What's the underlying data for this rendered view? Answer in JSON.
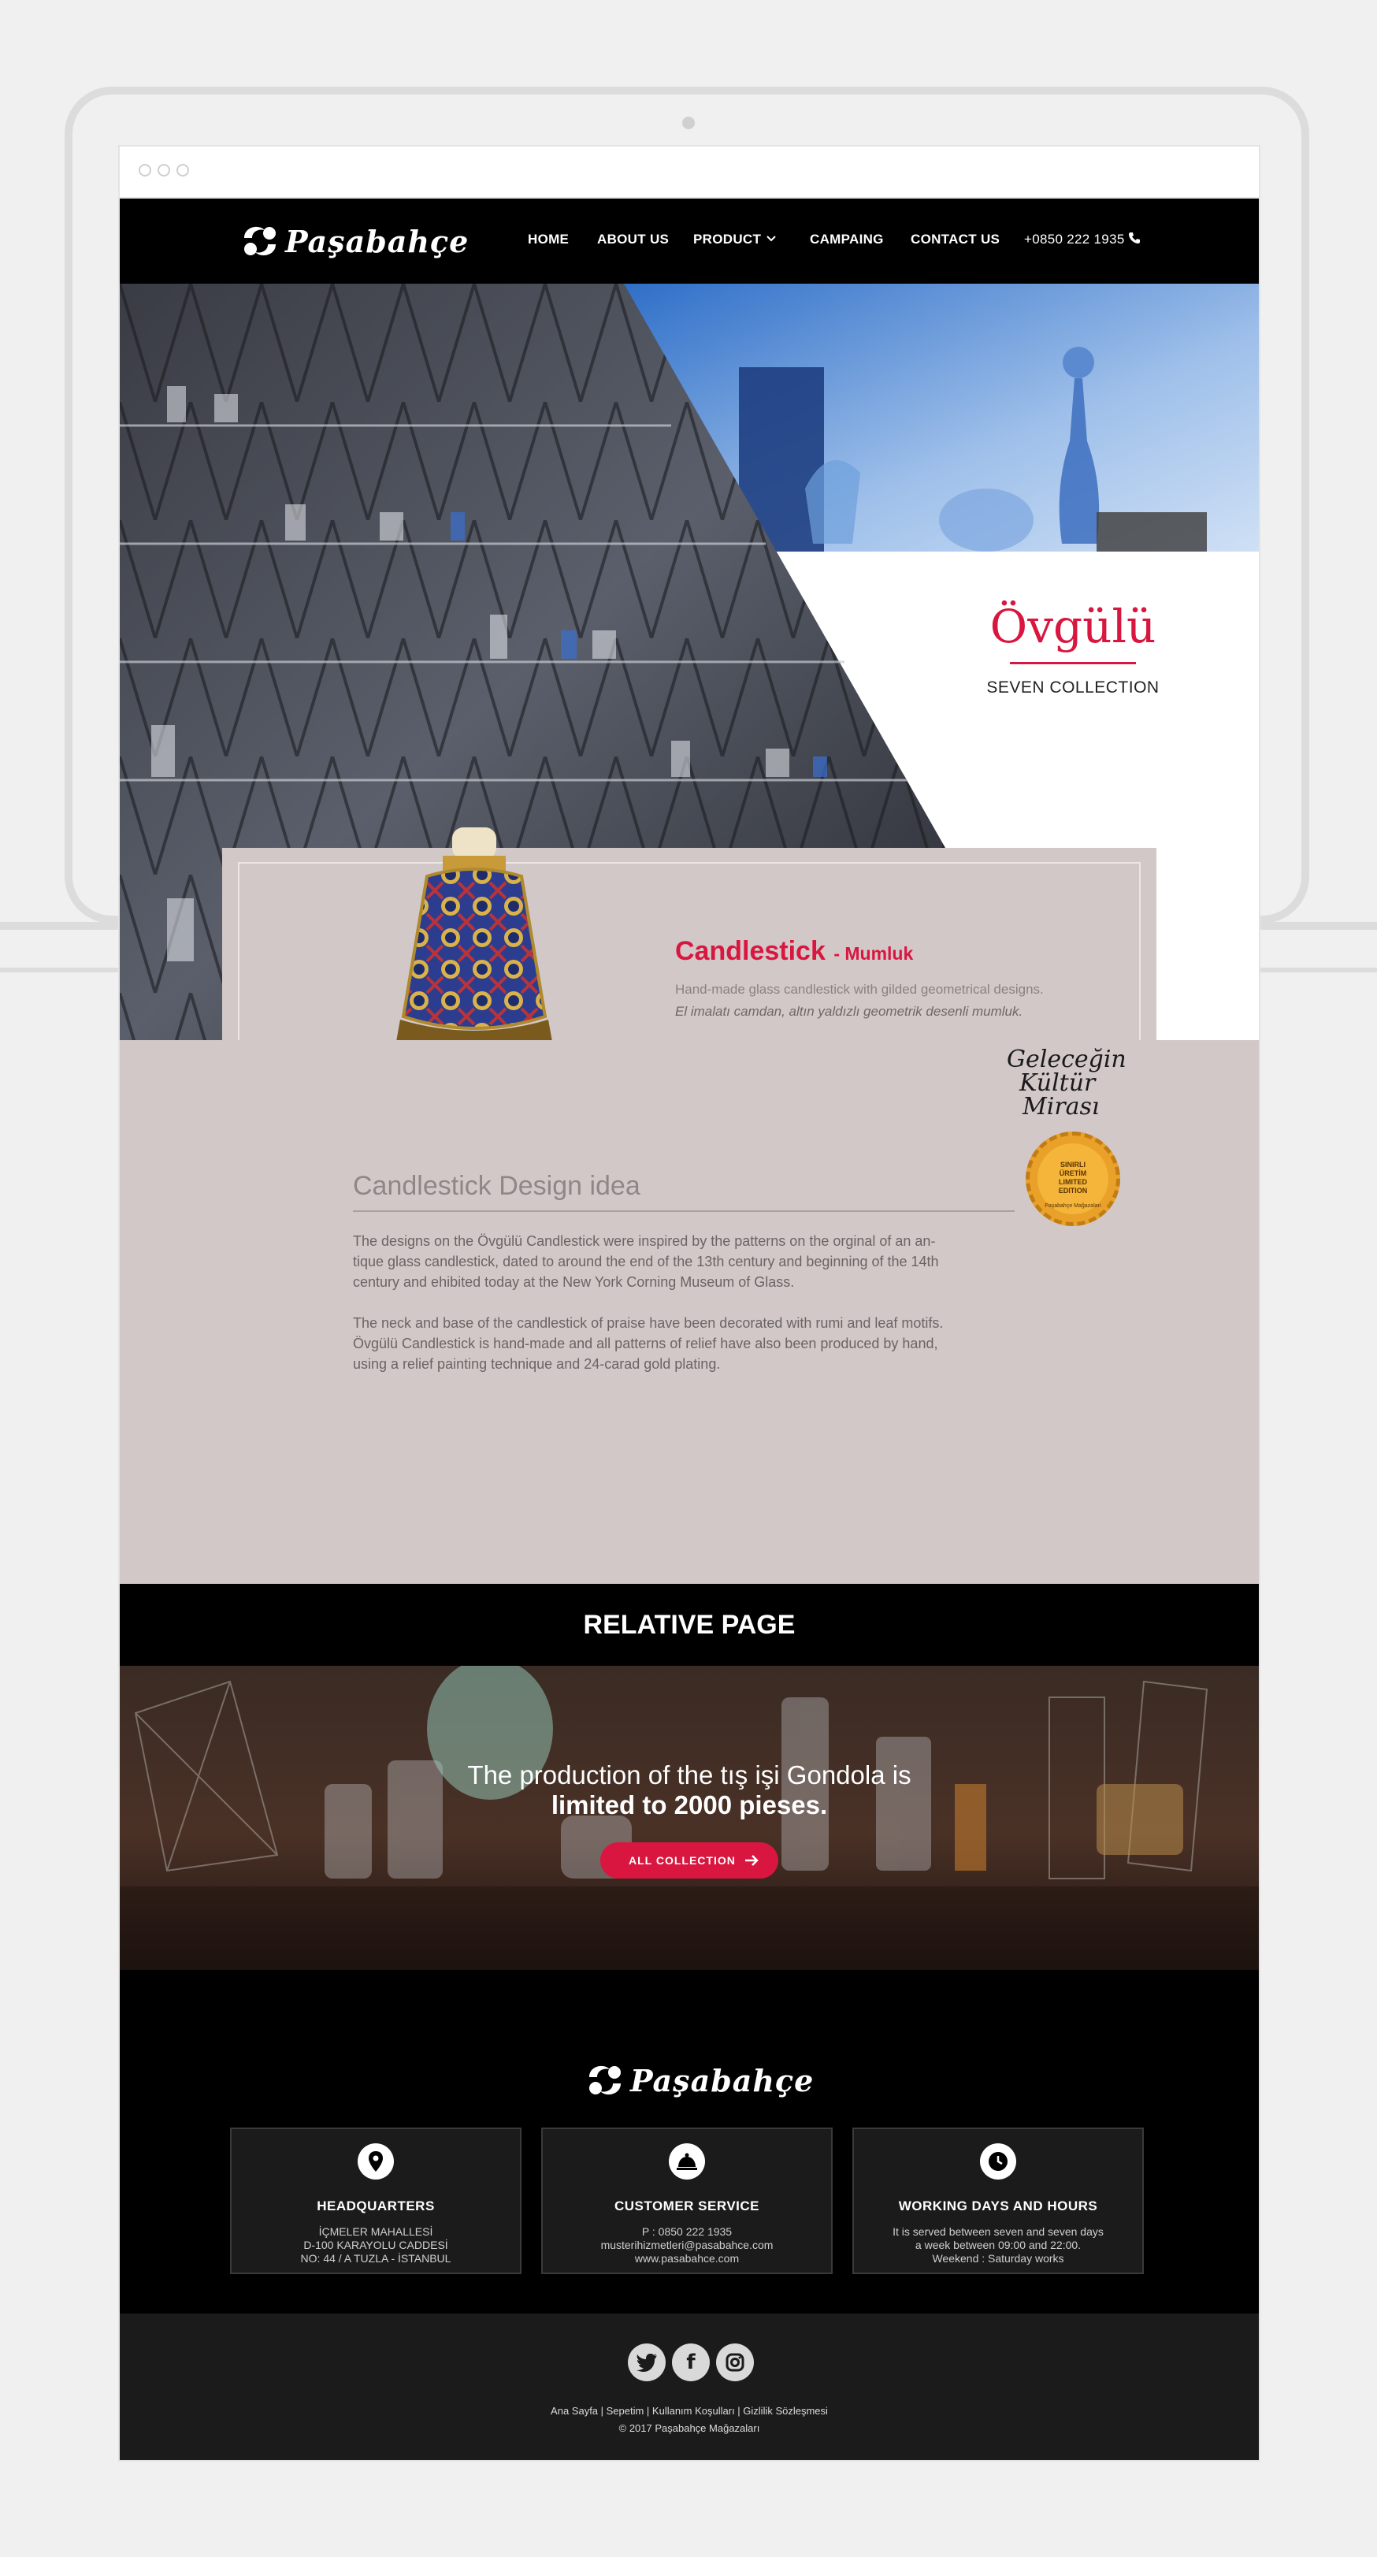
{
  "nav": {
    "brand": "Paşabahçe",
    "items": [
      "HOME",
      "ABOUT US",
      "PRODUCT",
      "CAMPAING",
      "CONTACT US"
    ],
    "phone": "+0850 222 1935"
  },
  "hero": {
    "collection_title": "Övgülü",
    "collection_subtitle": "SEVEN COLLECTION"
  },
  "product": {
    "title": "Candlestick",
    "subtitle": "- Mumluk",
    "desc_en": "Hand-made glass candlestick with gilded geometrical designs.",
    "desc_tr": "El imalatı camdan, altın yaldızlı geometrik desenli mumluk."
  },
  "badge": {
    "script_line1": "Geleceğin",
    "script_line2": "Kültür",
    "script_line3": "Mirası",
    "seal_line1": "SINIRLI",
    "seal_line2": "ÜRETİM",
    "seal_line3": "LIMITED",
    "seal_line4": "EDITION",
    "seal_ring": "Paşabahçe Mağazaları"
  },
  "design": {
    "heading": "Candlestick Design idea",
    "para1_l1": "The designs on the Övgülü Candlestick were inspired by the patterns on the orginal of an an-",
    "para1_l2": "tique glass candlestick, dated to around the end of the 13th century and beginning of the 14th",
    "para1_l3": "century and ehibited today at the New York Corning Museum of Glass.",
    "para2_l1": "The neck and base of the candlestick of praise have been decorated with rumi and leaf motifs.",
    "para2_l2": "Övgülü Candlestick is hand-made and all patterns of relief have also been produced by hand,",
    "para2_l3": "using a relief painting technique and 24-carad gold plating."
  },
  "relative": {
    "heading": "RELATIVE PAGE"
  },
  "banner": {
    "line1": "The production of the tış işi Gondola is",
    "line2": "limited to 2000 pieses.",
    "cta": "ALL COLLECTION"
  },
  "footer": {
    "brand": "Paşabahçe",
    "hq": {
      "title": "HEADQUARTERS",
      "l1": "İÇMELER MAHALLESİ",
      "l2": "D-100 KARAYOLU CADDESİ",
      "l3": "NO: 44 / A TUZLA - İSTANBUL"
    },
    "cs": {
      "title": "CUSTOMER SERVICE",
      "l1": "P : 0850 222 1935",
      "l2": "musterihizmetleri@pasabahce.com",
      "l3": "www.pasabahce.com"
    },
    "wd": {
      "title": "WORKING DAYS AND HOURS",
      "l1": "It is served between seven and seven days",
      "l2": "a week between 09:00 and 22:00.",
      "l3": "Weekend : Saturday works"
    },
    "links": "Ana Sayfa | Sepetim | Kullanım Koşulları | Gizlilik Sözleşmesi",
    "copyright": "© 2017 Paşabahçe Mağazaları"
  },
  "colors": {
    "accent": "#d9163f",
    "content_bg": "#d2c8c8",
    "dark": "#000000"
  }
}
